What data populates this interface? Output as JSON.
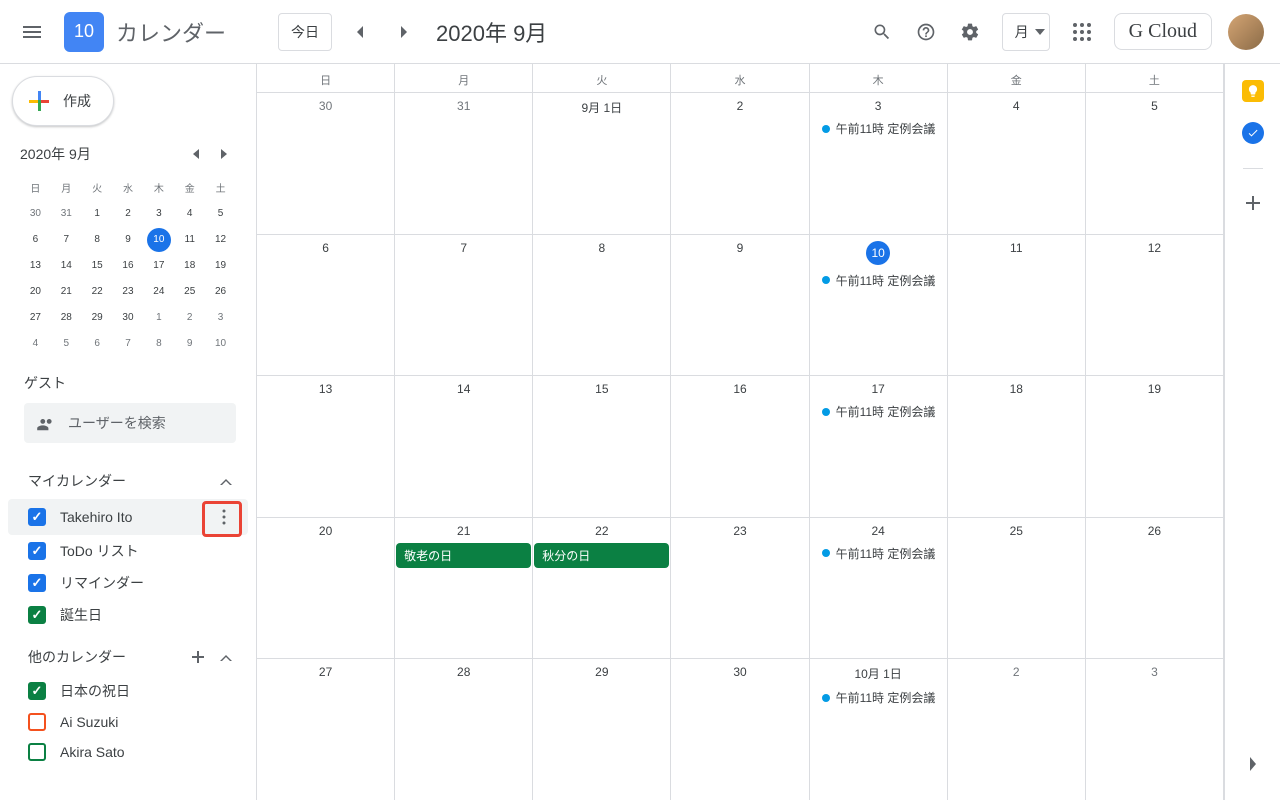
{
  "header": {
    "logo_text": "10",
    "app_title": "カレンダー",
    "today_label": "今日",
    "current_date": "2020年 9月",
    "view_label": "月",
    "brand": "G Cloud"
  },
  "create_label": "作成",
  "mini_cal": {
    "title": "2020年 9月",
    "dow": [
      "日",
      "月",
      "火",
      "水",
      "木",
      "金",
      "土"
    ],
    "days": [
      {
        "n": "30",
        "o": true
      },
      {
        "n": "31",
        "o": true
      },
      {
        "n": "1"
      },
      {
        "n": "2"
      },
      {
        "n": "3"
      },
      {
        "n": "4"
      },
      {
        "n": "5"
      },
      {
        "n": "6"
      },
      {
        "n": "7"
      },
      {
        "n": "8"
      },
      {
        "n": "9"
      },
      {
        "n": "10",
        "t": true
      },
      {
        "n": "11"
      },
      {
        "n": "12"
      },
      {
        "n": "13"
      },
      {
        "n": "14"
      },
      {
        "n": "15"
      },
      {
        "n": "16"
      },
      {
        "n": "17"
      },
      {
        "n": "18"
      },
      {
        "n": "19"
      },
      {
        "n": "20"
      },
      {
        "n": "21"
      },
      {
        "n": "22"
      },
      {
        "n": "23"
      },
      {
        "n": "24"
      },
      {
        "n": "25"
      },
      {
        "n": "26"
      },
      {
        "n": "27"
      },
      {
        "n": "28"
      },
      {
        "n": "29"
      },
      {
        "n": "30"
      },
      {
        "n": "1",
        "o": true
      },
      {
        "n": "2",
        "o": true
      },
      {
        "n": "3",
        "o": true
      },
      {
        "n": "4",
        "o": true
      },
      {
        "n": "5",
        "o": true
      },
      {
        "n": "6",
        "o": true
      },
      {
        "n": "7",
        "o": true
      },
      {
        "n": "8",
        "o": true
      },
      {
        "n": "9",
        "o": true
      },
      {
        "n": "10",
        "o": true
      }
    ]
  },
  "guest": {
    "label": "ゲスト",
    "placeholder": "ユーザーを検索"
  },
  "my_cal": {
    "title": "マイカレンダー",
    "items": [
      {
        "name": "Takehiro Ito",
        "color": "#1a73e8",
        "checked": true,
        "more": true,
        "hl": true
      },
      {
        "name": "ToDo リスト",
        "color": "#1a73e8",
        "checked": true
      },
      {
        "name": "リマインダー",
        "color": "#1a73e8",
        "checked": true
      },
      {
        "name": "誕生日",
        "color": "#0b8043",
        "checked": true
      }
    ]
  },
  "other_cal": {
    "title": "他のカレンダー",
    "items": [
      {
        "name": "日本の祝日",
        "color": "#0b8043",
        "checked": true
      },
      {
        "name": "Ai Suzuki",
        "color": "#f4511e",
        "checked": false
      },
      {
        "name": "Akira Sato",
        "color": "#0b8043",
        "checked": false
      }
    ]
  },
  "grid": {
    "dow": [
      "日",
      "月",
      "火",
      "水",
      "木",
      "金",
      "土"
    ],
    "weeks": [
      [
        {
          "label": "30",
          "o": true
        },
        {
          "label": "31",
          "o": true
        },
        {
          "label": "9月 1日"
        },
        {
          "label": "2"
        },
        {
          "label": "3",
          "events": [
            {
              "t": "午前11時 定例会議",
              "c": "#039be5"
            }
          ]
        },
        {
          "label": "4"
        },
        {
          "label": "5"
        }
      ],
      [
        {
          "label": "6"
        },
        {
          "label": "7"
        },
        {
          "label": "8"
        },
        {
          "label": "9"
        },
        {
          "label": "10",
          "today": true,
          "events": [
            {
              "t": "午前11時 定例会議",
              "c": "#039be5"
            }
          ]
        },
        {
          "label": "11"
        },
        {
          "label": "12"
        }
      ],
      [
        {
          "label": "13"
        },
        {
          "label": "14"
        },
        {
          "label": "15"
        },
        {
          "label": "16"
        },
        {
          "label": "17",
          "events": [
            {
              "t": "午前11時 定例会議",
              "c": "#039be5"
            }
          ]
        },
        {
          "label": "18"
        },
        {
          "label": "19"
        }
      ],
      [
        {
          "label": "20"
        },
        {
          "label": "21",
          "events": [
            {
              "t": "敬老の日",
              "allday": true,
              "bg": "#0b8043"
            }
          ]
        },
        {
          "label": "22",
          "events": [
            {
              "t": "秋分の日",
              "allday": true,
              "bg": "#0b8043"
            }
          ]
        },
        {
          "label": "23"
        },
        {
          "label": "24",
          "events": [
            {
              "t": "午前11時 定例会議",
              "c": "#039be5"
            }
          ]
        },
        {
          "label": "25"
        },
        {
          "label": "26"
        }
      ],
      [
        {
          "label": "27"
        },
        {
          "label": "28"
        },
        {
          "label": "29"
        },
        {
          "label": "30"
        },
        {
          "label": "10月 1日",
          "events": [
            {
              "t": "午前11時 定例会議",
              "c": "#039be5"
            }
          ]
        },
        {
          "label": "2",
          "o": true
        },
        {
          "label": "3",
          "o": true
        }
      ]
    ]
  }
}
